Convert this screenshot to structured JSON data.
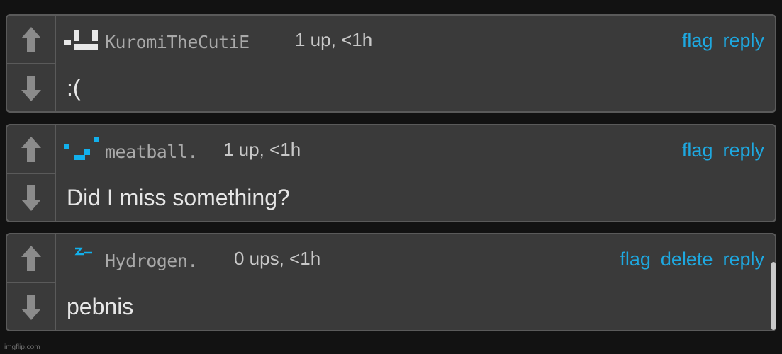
{
  "colors": {
    "accent": "#1ea8e0",
    "card_bg": "#3a3a3a",
    "border": "#5a5a5a",
    "page_bg": "#121212"
  },
  "comments": [
    {
      "avatar_icon": "kuromi-pixel-avatar-icon",
      "username": "KuromiTheCutiE",
      "meta": "1 up, <1h",
      "actions": [
        "flag",
        "reply"
      ],
      "text": ":("
    },
    {
      "avatar_icon": "meatball-pixel-avatar-icon",
      "username": "meatball.",
      "meta": "1 up, <1h",
      "actions": [
        "flag",
        "reply"
      ],
      "text": "Did I miss something?"
    },
    {
      "avatar_icon": "hydrogen-pixel-avatar-icon",
      "username": "Hydrogen.",
      "meta": "0 ups, <1h",
      "actions": [
        "flag",
        "delete",
        "reply"
      ],
      "text": "pebnis"
    }
  ],
  "watermark": "imgflip.com"
}
